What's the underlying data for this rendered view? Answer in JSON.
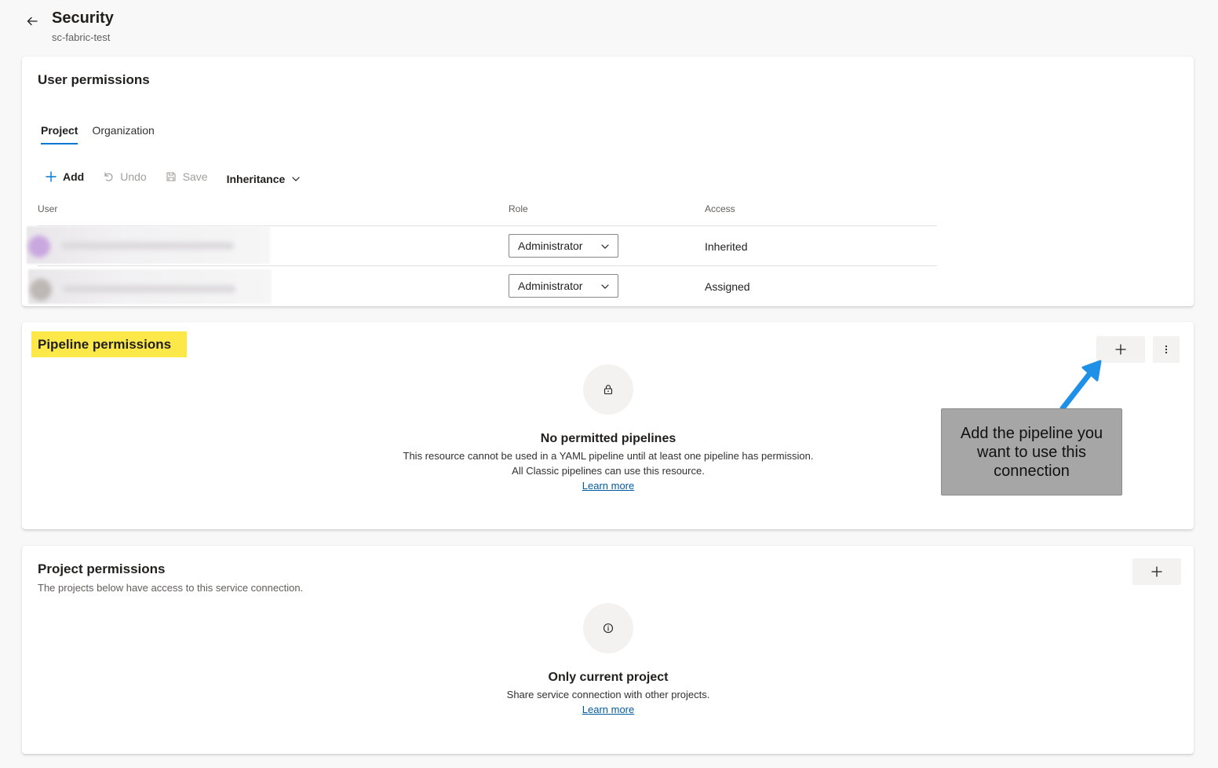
{
  "header": {
    "title": "Security",
    "subtitle": "sc-fabric-test"
  },
  "user_permissions": {
    "title": "User permissions",
    "tabs": [
      {
        "label": "Project",
        "active": true
      },
      {
        "label": "Organization",
        "active": false
      }
    ],
    "toolbar": {
      "add_label": "Add",
      "undo_label": "Undo",
      "save_label": "Save",
      "inheritance_label": "Inheritance"
    },
    "columns": {
      "user": "User",
      "role": "Role",
      "access": "Access"
    },
    "rows": [
      {
        "role": "Administrator",
        "access": "Inherited",
        "avatar_color": "#c9a7df"
      },
      {
        "role": "Administrator",
        "access": "Assigned",
        "avatar_color": "#bdb8b4"
      }
    ]
  },
  "pipeline_permissions": {
    "title": "Pipeline permissions",
    "empty_title": "No permitted pipelines",
    "empty_line1": "This resource cannot be used in a YAML pipeline until at least one pipeline has permission.",
    "empty_line2": "All Classic pipelines can use this resource.",
    "learn_more": "Learn more",
    "annotation": "Add the pipeline you want to use this connection"
  },
  "project_permissions": {
    "title": "Project permissions",
    "subtitle": "The projects below have access to this service connection.",
    "empty_title": "Only current project",
    "empty_line1": "Share service connection with other projects.",
    "learn_more": "Learn more"
  },
  "colors": {
    "accent": "#0078d4",
    "highlight": "#fde84a",
    "annotation_arrow": "#1e90e8",
    "link": "#005a9e"
  }
}
